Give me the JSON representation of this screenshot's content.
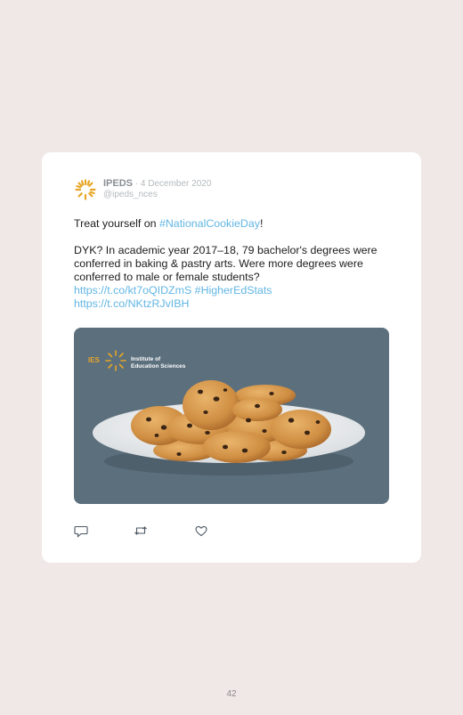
{
  "tweet": {
    "account_name": "IPEDS",
    "separator": " · ",
    "date": "4 December 2020",
    "handle": "@ipeds_nces",
    "line1_prefix": "Treat yourself on ",
    "hashtag_cookie": "#NationalCookieDay",
    "line1_suffix": "!",
    "paragraph2": "DYK? In academic year 2017–18, 79 bachelor's degrees were conferred in baking & pastry arts. Were more degrees were conferred to male or female students?",
    "link1": "https://t.co/kt7oQIDZmS",
    "hashtag_stats": "#HigherEdStats",
    "link2": "https://t.co/NKtzRJvIBH"
  },
  "media": {
    "logo_abbrev": "IES",
    "logo_line1": "Institute of",
    "logo_line2": "Education Sciences",
    "icon": "cookies-plate-image"
  },
  "actions": {
    "reply_icon": "reply-icon",
    "retweet_icon": "retweet-icon",
    "like_icon": "heart-icon"
  },
  "page": {
    "number": "42"
  },
  "colors": {
    "page_background": "#f0e8e6",
    "link": "#62b6e4",
    "logo_gold": "#e8a628",
    "media_background": "#5b6f7d"
  }
}
